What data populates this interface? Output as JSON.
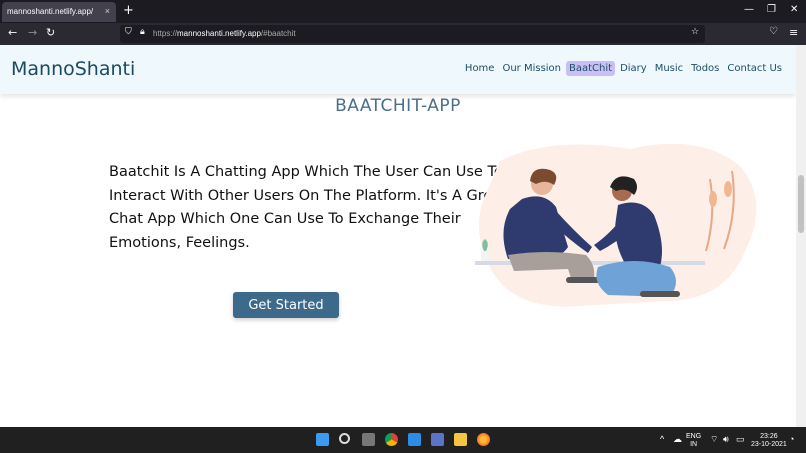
{
  "browser": {
    "tab_title": "mannoshanti.netlify.app/",
    "tab_close": "×",
    "new_tab": "+",
    "url_prefix": "https://",
    "url_host": "mannoshanti.netlify.app",
    "url_path": "/#baatchit"
  },
  "site": {
    "brand": "MannoShanti",
    "nav": [
      {
        "label": "Home",
        "active": false
      },
      {
        "label": "Our Mission",
        "active": false
      },
      {
        "label": "BaatChit",
        "active": true
      },
      {
        "label": "Diary",
        "active": false
      },
      {
        "label": "Music",
        "active": false
      },
      {
        "label": "Todos",
        "active": false
      },
      {
        "label": "Contact Us",
        "active": false
      }
    ],
    "section_title": "BAATCHIT-APP",
    "description": "Baatchit Is A Chatting App Which The User Can Use To Interact With Other Users On The Platform. It's A Group Chat App Which One Can Use To Exchange Their Emotions, Feelings.",
    "cta_label": "Get Started",
    "accent_color": "#3d6a8a",
    "active_nav_color": "#c9bff5"
  },
  "taskbar": {
    "lang_top": "ENG",
    "lang_bottom": "IN",
    "time": "23:26",
    "date": "23-10-2021"
  }
}
